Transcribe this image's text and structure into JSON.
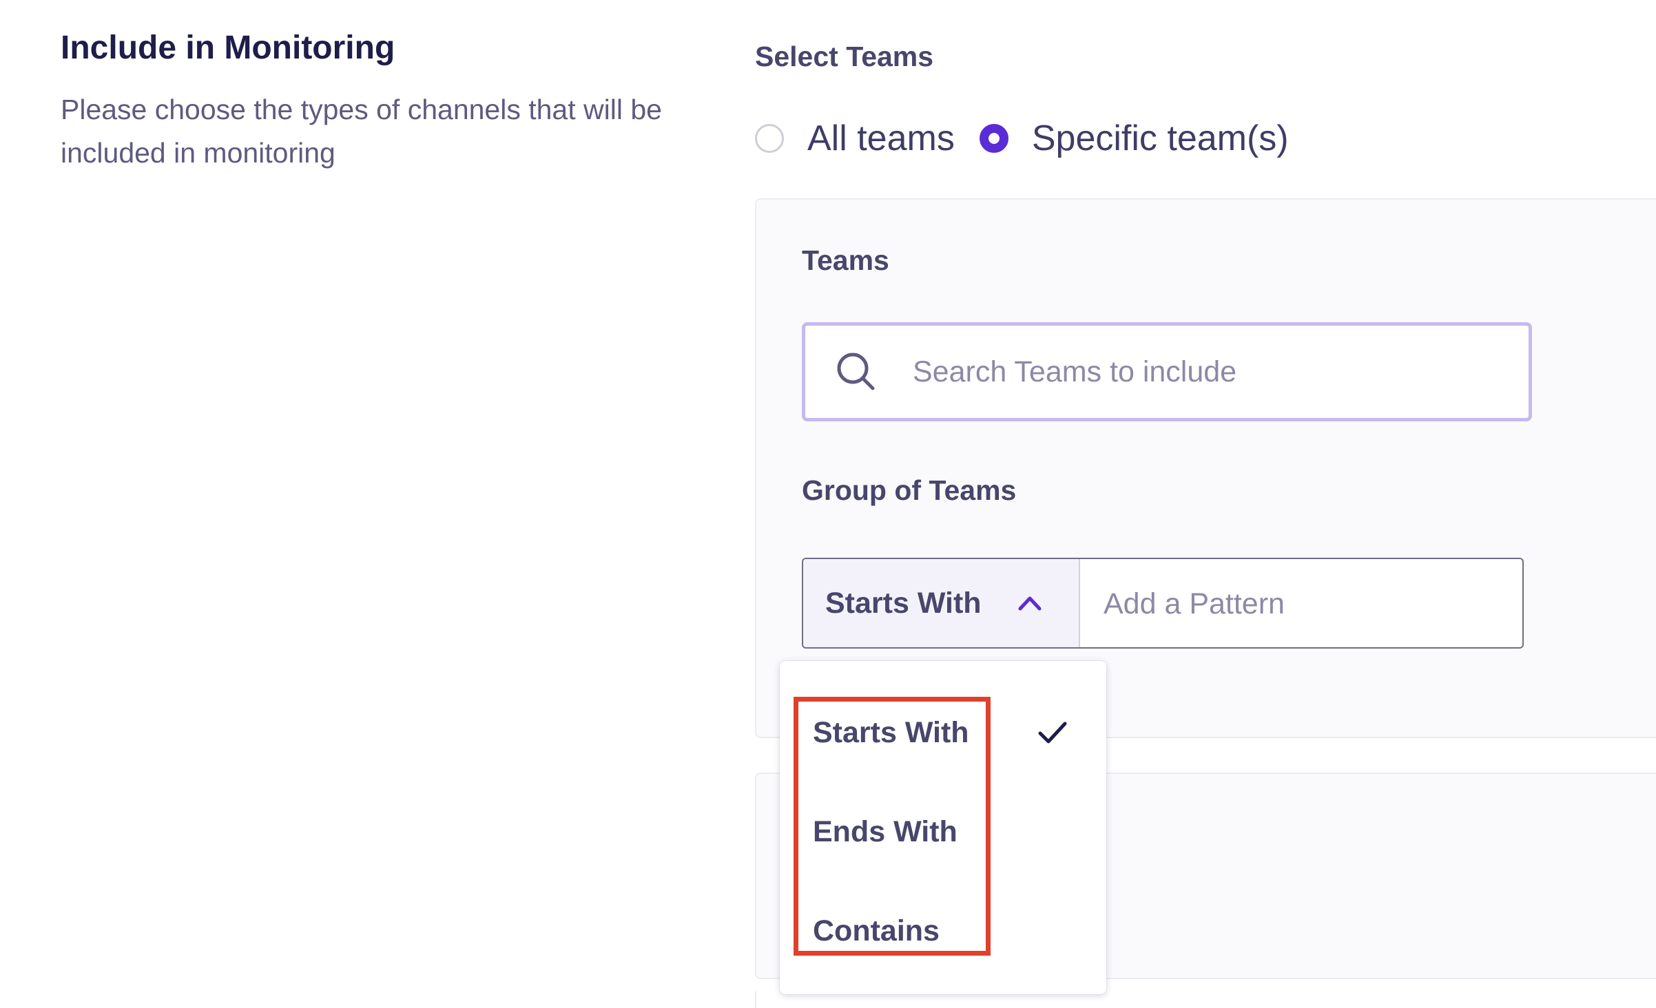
{
  "section": {
    "title": "Include in Monitoring",
    "description": "Please choose the types of channels that will be included in monitoring"
  },
  "select_teams": {
    "label": "Select Teams",
    "options": [
      {
        "label": "All teams",
        "selected": false
      },
      {
        "label": "Specific team(s)",
        "selected": true
      }
    ]
  },
  "teams": {
    "label": "Teams",
    "search_placeholder": "Search Teams to include"
  },
  "group_of_teams": {
    "label": "Group of Teams",
    "match_type_value": "Starts With",
    "pattern_placeholder": "Add a Pattern",
    "dropdown_open": true,
    "options": [
      {
        "label": "Starts With",
        "selected": true
      },
      {
        "label": "Ends With",
        "selected": false
      },
      {
        "label": "Contains",
        "selected": false
      }
    ]
  },
  "colors": {
    "accent": "#5b2bd6",
    "search_border": "#c6b9ef",
    "highlight": "#e0412c",
    "title_text": "#1f1d4a",
    "label_text": "#48466b"
  },
  "icons": [
    "search-icon",
    "chevron-up-icon",
    "check-icon"
  ]
}
